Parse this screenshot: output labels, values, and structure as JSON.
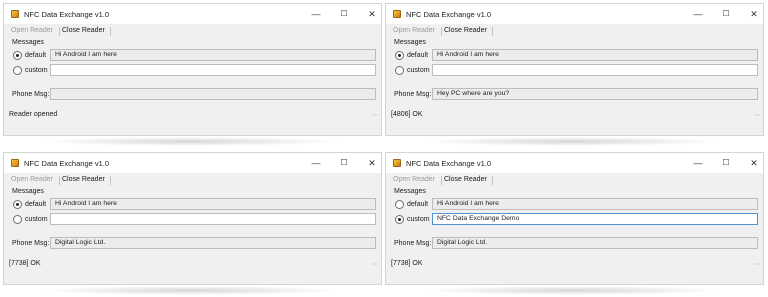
{
  "windows": [
    {
      "title": "NFC Data Exchange v1.0",
      "toolbar": {
        "open_reader": "Open Reader",
        "close_reader": "Close Reader"
      },
      "messages_label": "Messages",
      "default_label": "default",
      "custom_label": "custom",
      "selected": "default",
      "default_value": "Hi Android I am here",
      "custom_value": "",
      "phone_label": "Phone Msg:",
      "phone_value": "",
      "status": "Reader opened"
    },
    {
      "title": "NFC Data Exchange v1.0",
      "toolbar": {
        "open_reader": "Open Reader",
        "close_reader": "Close Reader"
      },
      "messages_label": "Messages",
      "default_label": "default",
      "custom_label": "custom",
      "selected": "default",
      "default_value": "Hi Android I am here",
      "custom_value": "",
      "phone_label": "Phone Msg:",
      "phone_value": "Hey PC where are you?",
      "status": "[4806] OK"
    },
    {
      "title": "NFC Data Exchange v1.0",
      "toolbar": {
        "open_reader": "Open Reader",
        "close_reader": "Close Reader"
      },
      "messages_label": "Messages",
      "default_label": "default",
      "custom_label": "custom",
      "selected": "default",
      "default_value": "Hi Android I am here",
      "custom_value": "",
      "phone_label": "Phone Msg:",
      "phone_value": "Digital Logic Ltd.",
      "status": "[7738] OK"
    },
    {
      "title": "NFC Data Exchange v1.0",
      "toolbar": {
        "open_reader": "Open Reader",
        "close_reader": "Close Reader"
      },
      "messages_label": "Messages",
      "default_label": "default",
      "custom_label": "custom",
      "selected": "custom",
      "default_value": "Hi Android I am here",
      "custom_value": "NFC Data Exchange Demo",
      "phone_label": "Phone Msg:",
      "phone_value": "Digital Logic Ltd.",
      "status": "[7738] OK"
    }
  ],
  "icons": {
    "app": "nfc-app-icon",
    "minimize": "minimize-icon",
    "maximize": "maximize-icon",
    "close": "close-icon",
    "resize_grip": "resize-grip-icon"
  },
  "colors": {
    "window_bg": "#f0f0f0",
    "titlebar_bg": "#ffffff",
    "readonly_field_bg": "#ececec",
    "focus_border": "#4f95d6",
    "disabled_text": "#9b9b9b"
  }
}
